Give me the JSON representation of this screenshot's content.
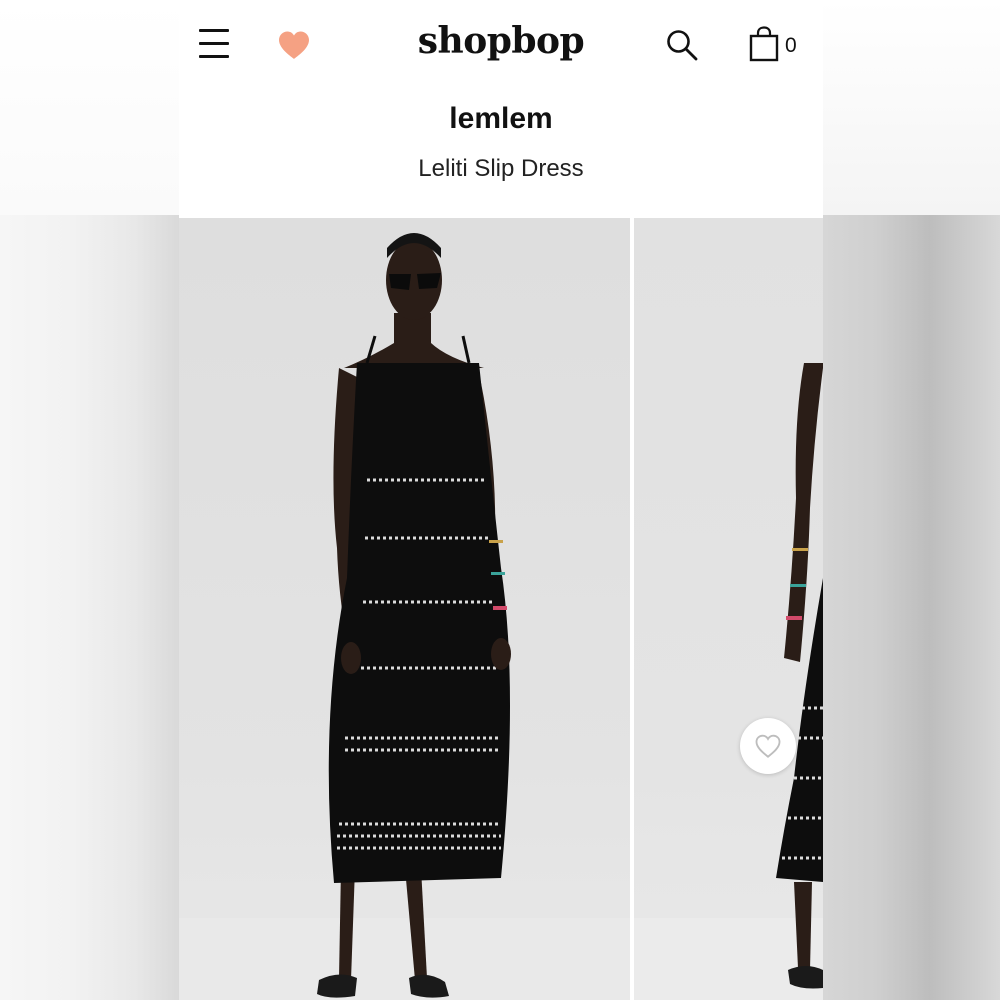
{
  "header": {
    "logo": "shopbop",
    "bag_count": "0",
    "heart_color": "#F5A183"
  },
  "product": {
    "brand": "lemlem",
    "name": "Leliti Slip Dress"
  },
  "gallery": {
    "images": [
      {
        "alt": "Model wearing black striped slip dress with sunglasses, front view"
      },
      {
        "alt": "Model wearing black striped slip dress, side view"
      }
    ]
  },
  "icons": {
    "menu": "hamburger-menu-icon",
    "favorites": "heart-icon",
    "search": "search-icon",
    "bag": "shopping-bag-icon",
    "wishlist": "heart-outline-icon"
  }
}
